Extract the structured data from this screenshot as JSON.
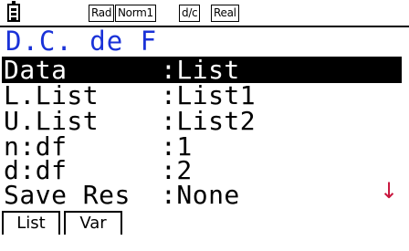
{
  "status_bar": {
    "badges": [
      "Rad",
      "Norm1",
      "d/c",
      "Real"
    ]
  },
  "title": "D.C. de F",
  "settings": [
    {
      "label": "Data",
      "value": ":List",
      "selected": true
    },
    {
      "label": "L.List",
      "value": ":List1",
      "selected": false
    },
    {
      "label": "U.List",
      "value": ":List2",
      "selected": false
    },
    {
      "label": "n:df",
      "value": ":1",
      "selected": false
    },
    {
      "label": "d:df",
      "value": ":2",
      "selected": false
    },
    {
      "label": "Save Res",
      "value": ":None",
      "selected": false
    }
  ],
  "scroll_arrow": "↓",
  "function_keys": [
    "List",
    "Var"
  ],
  "colors": {
    "title": "#1a32d8",
    "arrow": "#c8143c",
    "highlight": "#000000"
  }
}
